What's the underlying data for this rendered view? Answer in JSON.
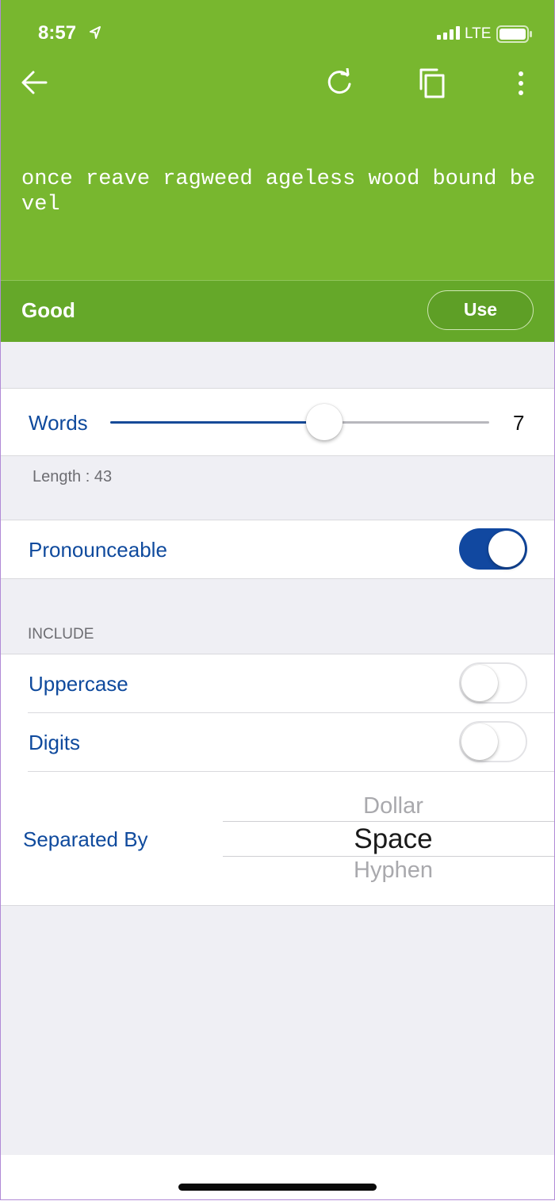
{
  "status_bar": {
    "time": "8:57",
    "network": "LTE",
    "icons": [
      "location-arrow-icon",
      "signal-bars-icon",
      "battery-icon"
    ]
  },
  "nav": {
    "icons": [
      "back-arrow-icon",
      "refresh-icon",
      "copy-icon",
      "more-vertical-icon"
    ]
  },
  "passphrase": "once reave ragweed ageless wood bound bevel",
  "strength": {
    "label": "Good",
    "use_label": "Use"
  },
  "words": {
    "label": "Words",
    "value": "7",
    "slider_fraction": 0.5
  },
  "length_note": "Length : 43",
  "pronounceable": {
    "label": "Pronounceable",
    "on": true
  },
  "include": {
    "header": "INCLUDE",
    "uppercase": {
      "label": "Uppercase",
      "on": false
    },
    "digits": {
      "label": "Digits",
      "on": false
    }
  },
  "separated_by": {
    "label": "Separated By",
    "options_above": [
      "Dollar"
    ],
    "selected": "Space",
    "options_below": [
      "Hyphen"
    ]
  },
  "colors": {
    "header_green": "#78b72f",
    "strength_green": "#65a829",
    "accent_blue": "#1148a0",
    "label_blue": "#0f4a9d",
    "grouped_background": "#efeff4"
  }
}
